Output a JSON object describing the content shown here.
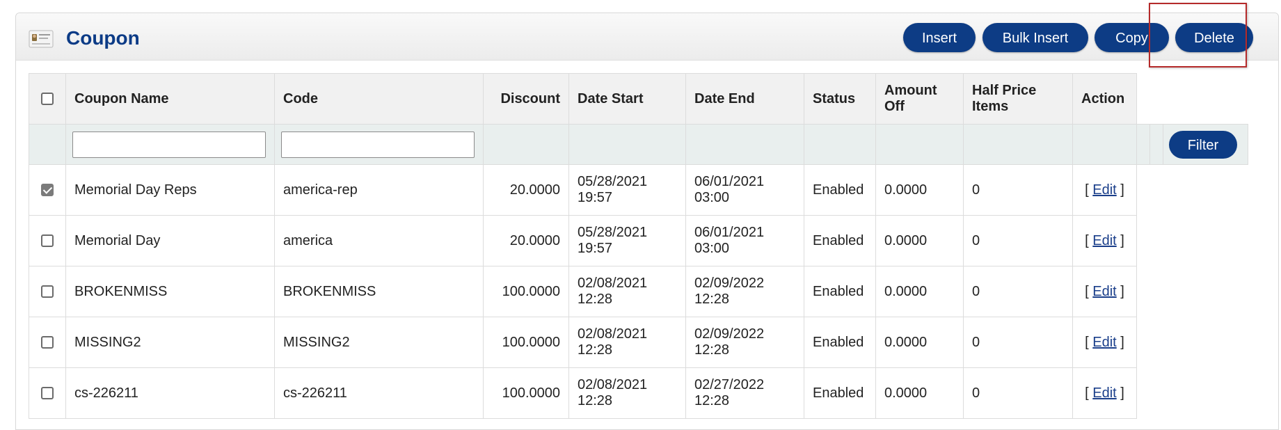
{
  "header": {
    "title": "Coupon",
    "icon": "coupon-card-icon",
    "buttons": {
      "insert": "Insert",
      "bulk_insert": "Bulk Insert",
      "copy": "Copy",
      "delete": "Delete"
    },
    "highlight_color": "#b52a2a"
  },
  "colors": {
    "primary_button": "#0d3c85",
    "title": "#0c3b86"
  },
  "table": {
    "columns": [
      "Coupon Name",
      "Code",
      "Discount",
      "Date Start",
      "Date End",
      "Status",
      "Amount Off",
      "Half Price Items",
      "Action"
    ],
    "filter": {
      "name_value": "",
      "code_value": "",
      "button": "Filter"
    },
    "rows": [
      {
        "checked": true,
        "name": "Memorial Day Reps",
        "code": "america-rep",
        "discount": "20.0000",
        "date_start_date": "05/28/2021",
        "date_start_time": "19:57",
        "date_end_date": "06/01/2021",
        "date_end_time": "03:00",
        "status": "Enabled",
        "amount_off": "0.0000",
        "half_price": "0",
        "action_open": "[",
        "action_label": "Edit",
        "action_close": "]"
      },
      {
        "checked": false,
        "name": "Memorial Day",
        "code": "america",
        "discount": "20.0000",
        "date_start_date": "05/28/2021",
        "date_start_time": "19:57",
        "date_end_date": "06/01/2021",
        "date_end_time": "03:00",
        "status": "Enabled",
        "amount_off": "0.0000",
        "half_price": "0",
        "action_open": "[",
        "action_label": "Edit",
        "action_close": "]"
      },
      {
        "checked": false,
        "name": "BROKENMISS",
        "code": "BROKENMISS",
        "discount": "100.0000",
        "date_start_date": "02/08/2021",
        "date_start_time": "12:28",
        "date_end_date": "02/09/2022",
        "date_end_time": "12:28",
        "status": "Enabled",
        "amount_off": "0.0000",
        "half_price": "0",
        "action_open": "[",
        "action_label": "Edit",
        "action_close": "]"
      },
      {
        "checked": false,
        "name": "MISSING2",
        "code": "MISSING2",
        "discount": "100.0000",
        "date_start_date": "02/08/2021",
        "date_start_time": "12:28",
        "date_end_date": "02/09/2022",
        "date_end_time": "12:28",
        "status": "Enabled",
        "amount_off": "0.0000",
        "half_price": "0",
        "action_open": "[",
        "action_label": "Edit",
        "action_close": "]"
      },
      {
        "checked": false,
        "name": "cs-226211",
        "code": "cs-226211",
        "discount": "100.0000",
        "date_start_date": "02/08/2021",
        "date_start_time": "12:28",
        "date_end_date": "02/27/2022",
        "date_end_time": "12:28",
        "status": "Enabled",
        "amount_off": "0.0000",
        "half_price": "0",
        "action_open": "[",
        "action_label": "Edit",
        "action_close": "]"
      }
    ]
  }
}
